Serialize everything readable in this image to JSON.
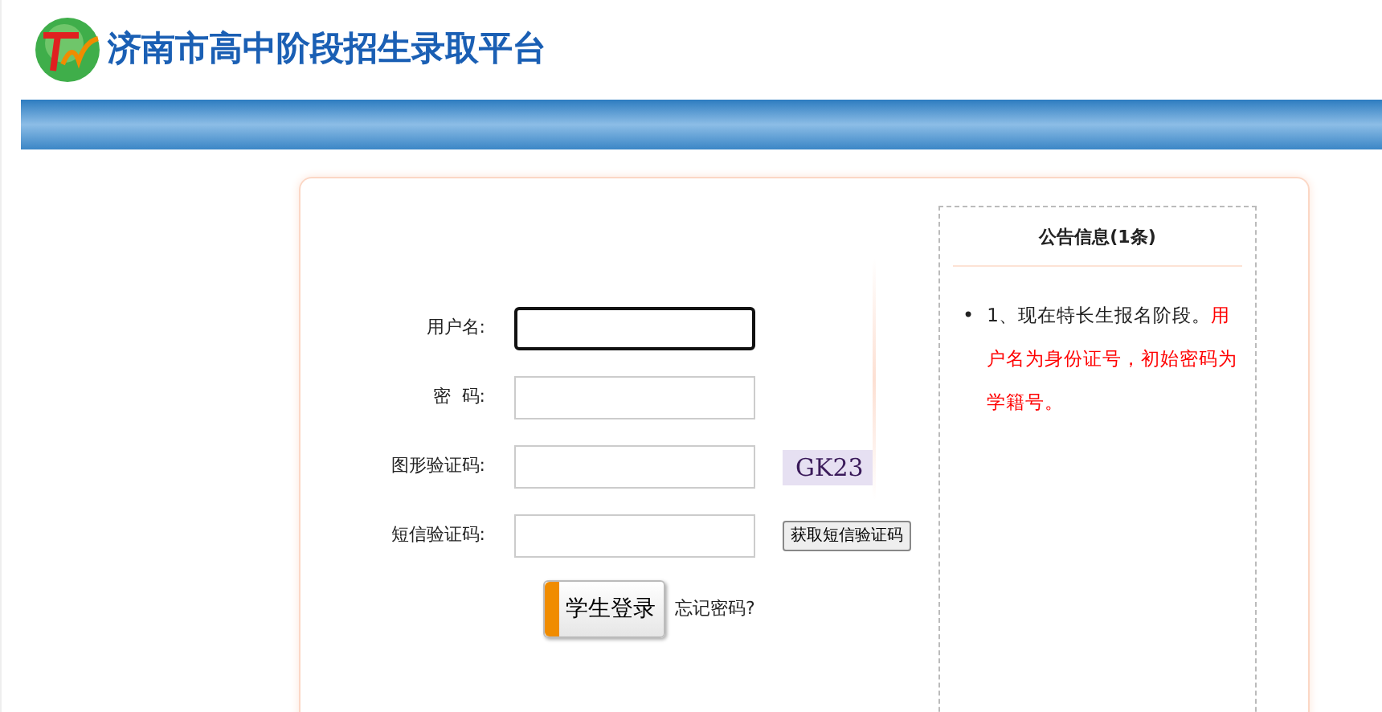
{
  "header": {
    "title": "济南市高中阶段招生录取平台"
  },
  "form": {
    "fields": [
      {
        "label": "用户名:",
        "kind": "text",
        "focused": true
      },
      {
        "label": "密  码:",
        "kind": "password",
        "focused": false
      },
      {
        "label": "图形验证码:",
        "kind": "captcha",
        "focused": false,
        "captcha": "GK23"
      },
      {
        "label": "短信验证码:",
        "kind": "sms",
        "focused": false,
        "button": "获取短信验证码"
      }
    ],
    "login_button": "学生登录",
    "forgot_link": "忘记密码?"
  },
  "notice": {
    "title": "公告信息(1条)",
    "items": [
      {
        "bullet": "•",
        "parts": [
          {
            "kind": "plain",
            "text": "1、现在特长生报名阶段。"
          },
          {
            "kind": "highlight",
            "text": "用户名为身份证号，初始密码为学籍号。"
          }
        ]
      }
    ]
  }
}
